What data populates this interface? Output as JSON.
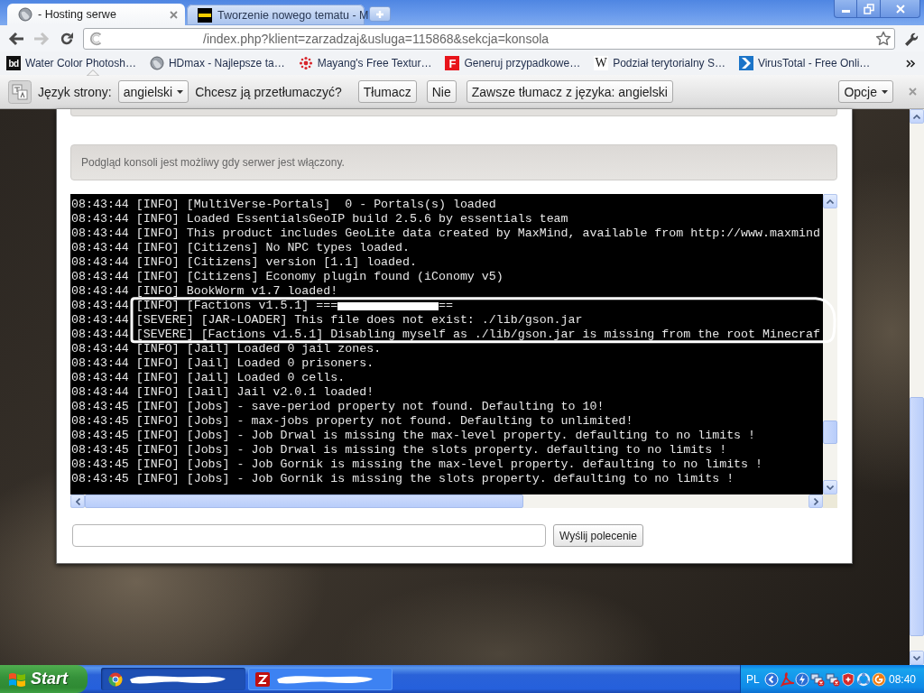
{
  "tabs": [
    {
      "title": "- Hosting serwe",
      "selected": true,
      "kind": "globe"
    },
    {
      "title": "Tworzenie nowego tematu - M",
      "selected": false,
      "kind": "mpc"
    }
  ],
  "toolbar": {
    "back_disabled": false,
    "forward_disabled": true,
    "url": "/index.php?klient=zarzadzaj&usluga=115868&sekcja=konsola"
  },
  "bookmarks": [
    {
      "label": "Water Color Photosh…",
      "kind": "dark-tile",
      "icon_text": "bd"
    },
    {
      "label": "HDmax - Najlepsze ta…",
      "kind": "globe"
    },
    {
      "label": "Mayang's Free Textur…",
      "kind": "dots"
    },
    {
      "label": "Generuj przypadkowe…",
      "kind": "red-tile",
      "icon_text": "F"
    },
    {
      "label": "Podział terytorialny S…",
      "kind": "serif-tile",
      "icon_text": "W"
    },
    {
      "label": "VirusTotal - Free Onli…",
      "kind": "arrow-tile"
    }
  ],
  "translate_bar": {
    "label": "Język strony:",
    "language": "angielski",
    "question": "Chcesz ją przetłumaczyć?",
    "buttons": [
      "Tłumacz",
      "Nie",
      "Zawsze tłumacz z języka: angielski"
    ],
    "options": "Opcje"
  },
  "panel": {
    "notice": "Podgląd konsoli jest możliwy gdy serwer jest włączony.",
    "console": {
      "lines": [
        {
          "text": "08:43:44 [INFO] [MultiVerse-Portals]  0 - Portals(s) loaded"
        },
        {
          "text": "08:43:44 [INFO] Loaded EssentialsGeoIP build 2.5.6 by essentials team"
        },
        {
          "text": "08:43:44 [INFO] This product includes GeoLite data created by MaxMind, available from http://www.maxmind"
        },
        {
          "text": "08:43:44 [INFO] [Citizens] No NPC types loaded."
        },
        {
          "text": "08:43:44 [INFO] [Citizens] version [1.1] loaded."
        },
        {
          "text": "08:43:44 [INFO] [Citizens] Economy plugin found (iConomy v5)"
        },
        {
          "text": "08:43:44 [INFO] BookWorm v1.7 loaded!"
        },
        {
          "text": "08:43:44 [INFO] [Factions v1.5.1] ===",
          "tail": "=="
        },
        {
          "text": "08:43:44 [SEVERE] [JAR-LOADER] This file does not exist: ./lib/gson.jar"
        },
        {
          "text": "08:43:44 [SEVERE] [Factions v1.5.1] Disabling myself as ./lib/gson.jar is missing from the root Minecraf"
        },
        {
          "text": "08:43:44 [INFO] [Jail] Loaded 0 jail zones."
        },
        {
          "text": "08:43:44 [INFO] [Jail] Loaded 0 prisoners."
        },
        {
          "text": "08:43:44 [INFO] [Jail] Loaded 0 cells."
        },
        {
          "text": "08:43:44 [INFO] [Jail] Jail v2.0.1 loaded!"
        },
        {
          "text": "08:43:45 [INFO] [Jobs] - save-period property not found. Defaulting to 10!"
        },
        {
          "text": "08:43:45 [INFO] [Jobs] - max-jobs property not found. Defaulting to unlimited!"
        },
        {
          "text": "08:43:45 [INFO] [Jobs] - Job Drwal is missing the max-level property. defaulting to no limits !"
        },
        {
          "text": "08:43:45 [INFO] [Jobs] - Job Drwal is missing the slots property. defaulting to no limits !"
        },
        {
          "text": "08:43:45 [INFO] [Jobs] - Job Gornik is missing the max-level property. defaulting to no limits !"
        },
        {
          "text": "08:43:45 [INFO] [Jobs] - Job Gornik is missing the slots property. defaulting to no limits !"
        }
      ]
    },
    "send_button": "Wyślij polecenie"
  },
  "taskbar": {
    "start": "Start",
    "tasks": [
      {
        "kind": "chrome",
        "selected": true
      },
      {
        "kind": "filezilla",
        "selected": false
      }
    ],
    "language": "PL",
    "clock": "08:40"
  }
}
